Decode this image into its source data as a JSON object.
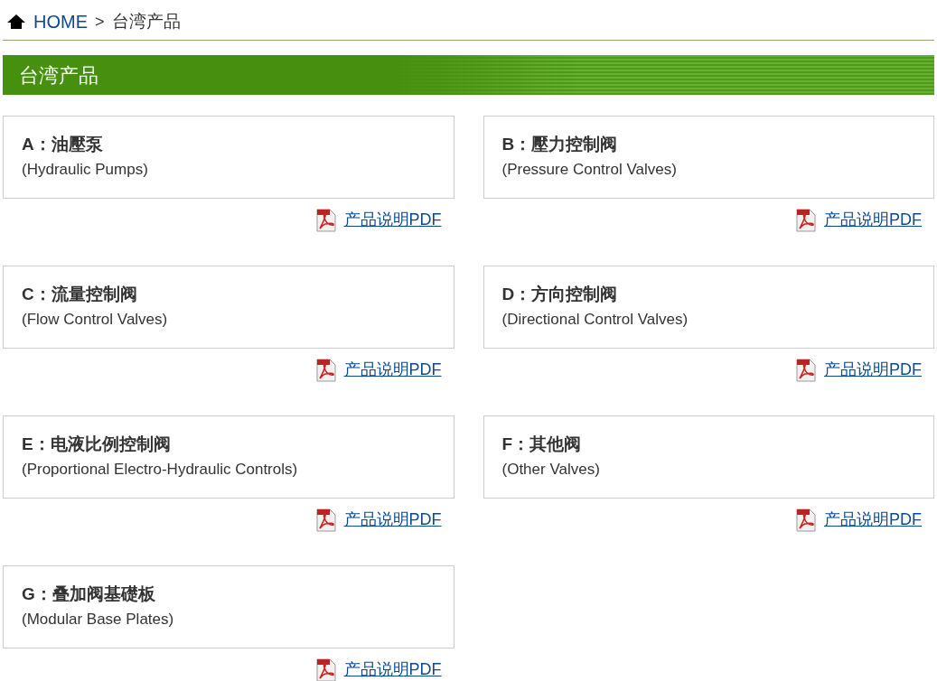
{
  "breadcrumb": {
    "home": "HOME",
    "separator": ">",
    "current": "台湾产品"
  },
  "section_title": "台湾产品",
  "products": [
    {
      "title": "A：油壓泵",
      "subtitle": "(Hydraulic Pumps)",
      "link": "产品说明PDF"
    },
    {
      "title": "B：壓力控制阀",
      "subtitle": "(Pressure Control Valves)",
      "link": "产品说明PDF"
    },
    {
      "title": "C：流量控制阀",
      "subtitle": "(Flow Control Valves)",
      "link": "产品说明PDF"
    },
    {
      "title": "D：方向控制阀",
      "subtitle": "(Directional Control Valves)",
      "link": "产品说明PDF"
    },
    {
      "title": "E：电液比例控制阀",
      "subtitle": "(Proportional Electro-Hydraulic Controls)",
      "link": "产品说明PDF"
    },
    {
      "title": "F：其他阀",
      "subtitle": "(Other Valves)",
      "link": "产品说明PDF"
    },
    {
      "title": "G：叠加阀基礎板",
      "subtitle": "(Modular Base Plates)",
      "link": "产品说明PDF"
    }
  ]
}
